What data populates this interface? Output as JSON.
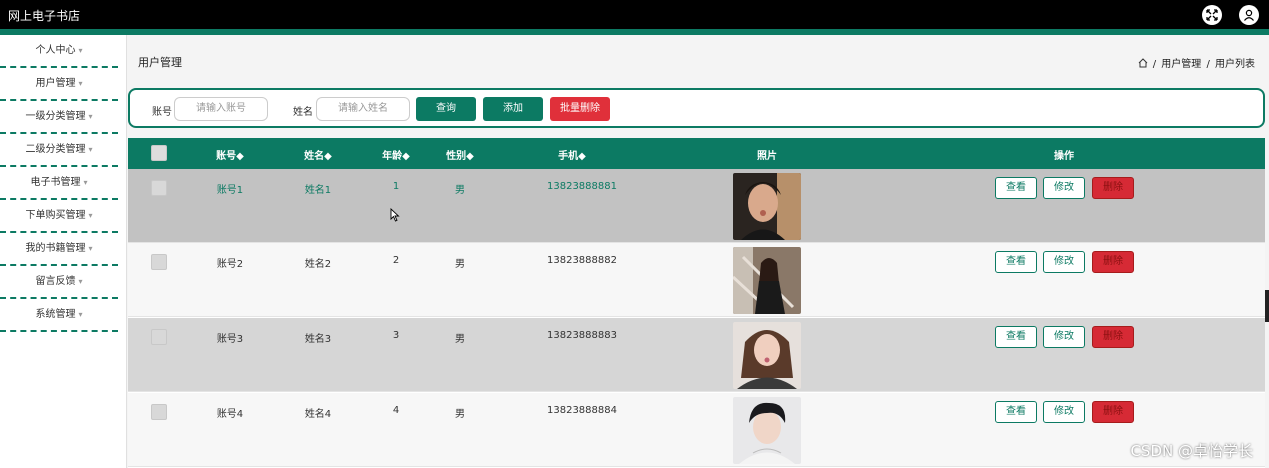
{
  "app": {
    "title": "网上电子书店"
  },
  "sidebar": {
    "items": [
      {
        "label": "个人中心"
      },
      {
        "label": "用户管理"
      },
      {
        "label": "一级分类管理"
      },
      {
        "label": "二级分类管理"
      },
      {
        "label": "电子书管理"
      },
      {
        "label": "下单购买管理"
      },
      {
        "label": "我的书籍管理"
      },
      {
        "label": "留言反馈"
      },
      {
        "label": "系统管理"
      }
    ],
    "caret": "▾"
  },
  "page": {
    "title": "用户管理",
    "breadcrumb": [
      "用户管理",
      "用户列表"
    ],
    "breadcrumb_sep": "/"
  },
  "search": {
    "account_label": "账号",
    "account_placeholder": "请输入账号",
    "name_label": "姓名",
    "name_placeholder": "请输入姓名",
    "query_label": "查询",
    "add_label": "添加",
    "batch_delete_label": "批量删除"
  },
  "table": {
    "columns": [
      "账号",
      "姓名",
      "年龄",
      "性别",
      "手机",
      "照片",
      "操作"
    ],
    "sort_mark": "◆",
    "rows": [
      {
        "account": "账号1",
        "name": "姓名1",
        "age": "1",
        "gender": "男",
        "phone": "13823888881"
      },
      {
        "account": "账号2",
        "name": "姓名2",
        "age": "2",
        "gender": "男",
        "phone": "13823888882"
      },
      {
        "account": "账号3",
        "name": "姓名3",
        "age": "3",
        "gender": "男",
        "phone": "13823888883"
      },
      {
        "account": "账号4",
        "name": "姓名4",
        "age": "4",
        "gender": "男",
        "phone": "13823888884"
      }
    ],
    "actions": {
      "view": "查看",
      "edit": "修改",
      "delete": "删除"
    }
  },
  "watermark": "CSDN @卓怡学长",
  "colors": {
    "accent": "#0c7a63",
    "danger": "#e0303a",
    "topbar": "#000000"
  }
}
